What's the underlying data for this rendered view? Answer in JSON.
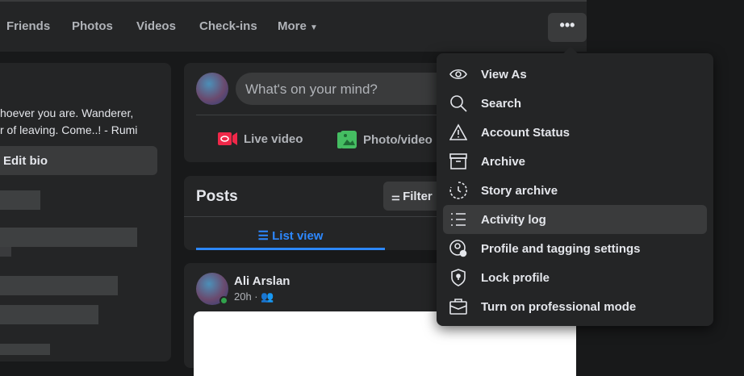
{
  "nav": {
    "tabs": [
      "Friends",
      "Photos",
      "Videos",
      "Check-ins",
      "More"
    ],
    "more_label": "More",
    "menu_button": "•••"
  },
  "intro": {
    "bio_line1": "hoever you are. Wanderer,",
    "bio_line2": "r of leaving. Come..! - Rumi",
    "edit_bio": "Edit bio"
  },
  "composer": {
    "placeholder": "What's on your mind?",
    "live_video": "Live video",
    "photo_video": "Photo/video"
  },
  "posts": {
    "title": "Posts",
    "filter": "Filter",
    "list_view": "List view"
  },
  "post": {
    "author": "Ali Arslan",
    "time": "20h · "
  },
  "menu": {
    "items": [
      {
        "label": "View As",
        "icon": "eye-icon"
      },
      {
        "label": "Search",
        "icon": "search-icon"
      },
      {
        "label": "Account Status",
        "icon": "warning-icon"
      },
      {
        "label": "Archive",
        "icon": "archive-icon"
      },
      {
        "label": "Story archive",
        "icon": "story-archive-icon"
      },
      {
        "label": "Activity log",
        "icon": "list-icon"
      },
      {
        "label": "Profile and tagging settings",
        "icon": "profile-settings-icon"
      },
      {
        "label": "Lock profile",
        "icon": "shield-lock-icon"
      },
      {
        "label": "Turn on professional mode",
        "icon": "briefcase-icon"
      }
    ]
  },
  "colors": {
    "accent": "#2d88ff",
    "live": "#f02849",
    "photo": "#45bd62",
    "online": "#31a24c"
  }
}
